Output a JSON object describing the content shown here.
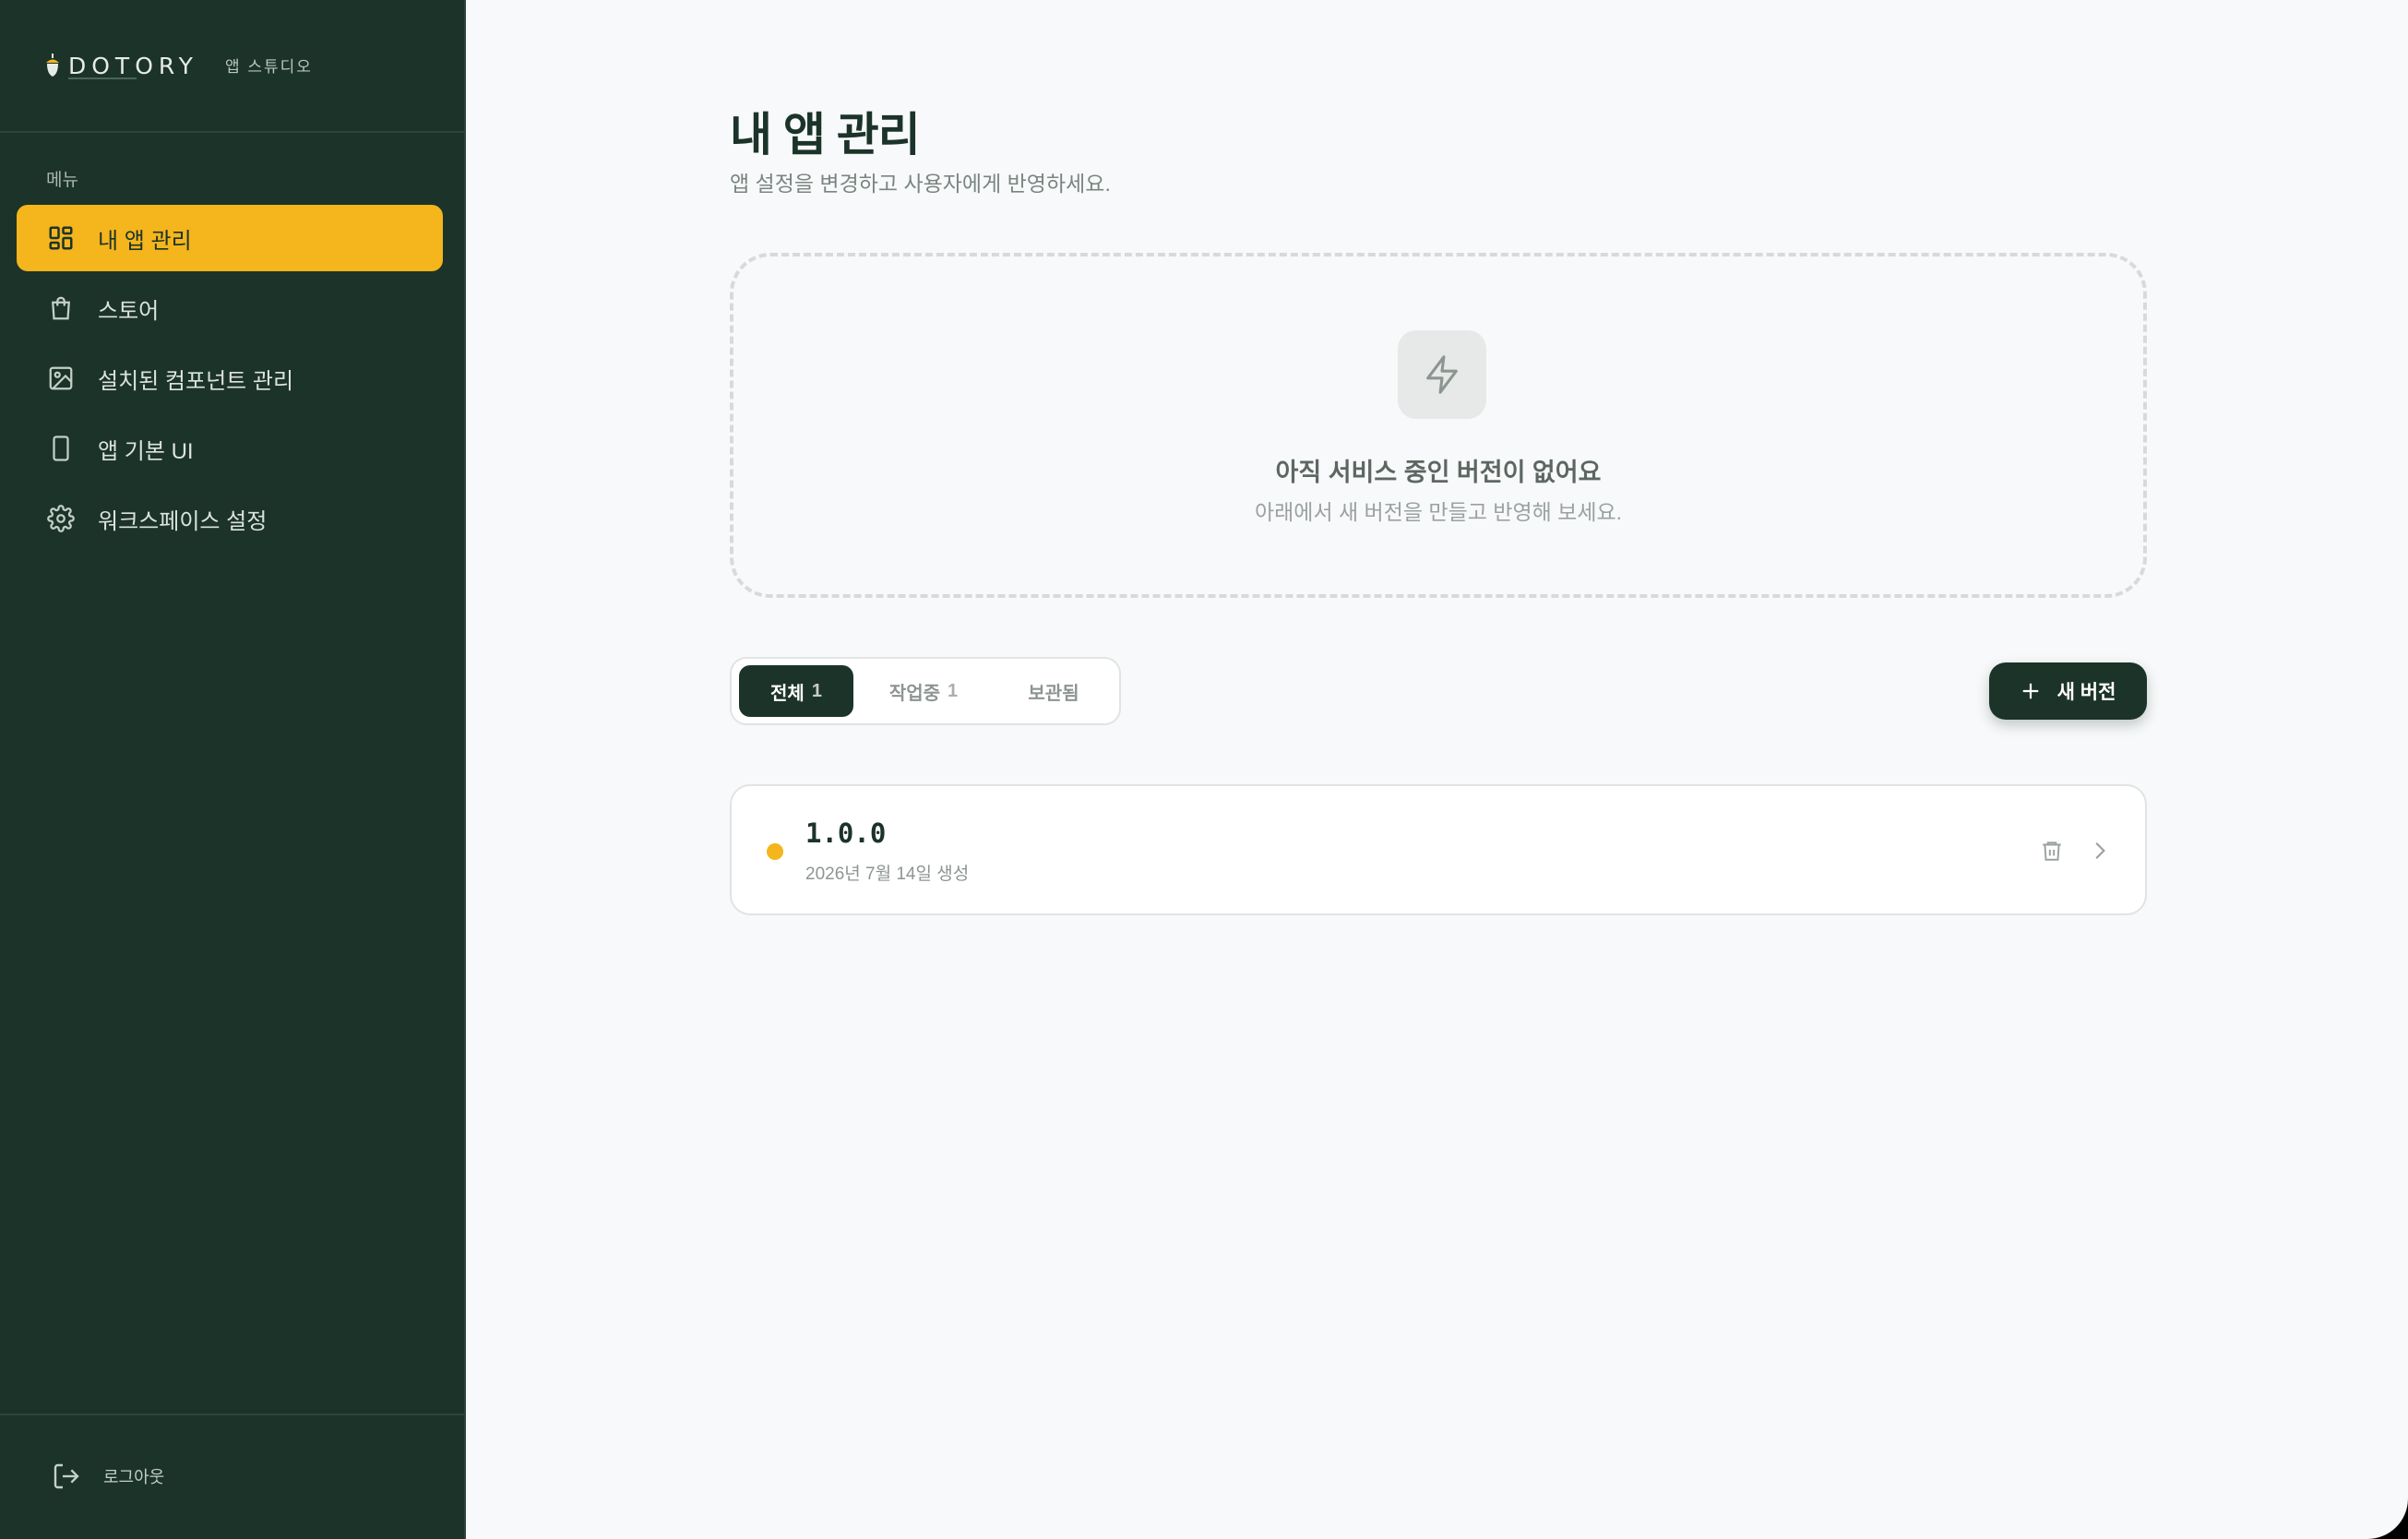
{
  "brand": {
    "logo_text": "DOTORY",
    "subtitle": "앱 스튜디오"
  },
  "sidebar": {
    "menu_label": "메뉴",
    "items": [
      {
        "label": "내 앱 관리",
        "icon": "grid-icon",
        "active": true
      },
      {
        "label": "스토어",
        "icon": "shopping-bag-icon",
        "active": false
      },
      {
        "label": "설치된 컴포넌트 관리",
        "icon": "image-icon",
        "active": false
      },
      {
        "label": "앱 기본 UI",
        "icon": "smartphone-icon",
        "active": false
      },
      {
        "label": "워크스페이스 설정",
        "icon": "gear-icon",
        "active": false
      }
    ],
    "logout_label": "로그아웃"
  },
  "main": {
    "title": "내 앱 관리",
    "subtitle": "앱 설정을 변경하고 사용자에게 반영하세요.",
    "empty_state": {
      "icon": "lightning-icon",
      "title": "아직 서비스 중인 버전이 없어요",
      "description": "아래에서 새 버전을 만들고 반영해 보세요."
    },
    "tabs": [
      {
        "label": "전체",
        "count": "1",
        "active": true
      },
      {
        "label": "작업중",
        "count": "1",
        "active": false
      },
      {
        "label": "보관됨",
        "count": "",
        "active": false
      }
    ],
    "new_version_button": "새 버전",
    "versions": [
      {
        "name": "1.0.0",
        "created": "2026년 7월 14일 생성",
        "status_color": "#f5b51c"
      }
    ]
  },
  "colors": {
    "sidebar_bg": "#1c3329",
    "accent": "#f5b51c",
    "page_bg": "#f8f9fa"
  }
}
